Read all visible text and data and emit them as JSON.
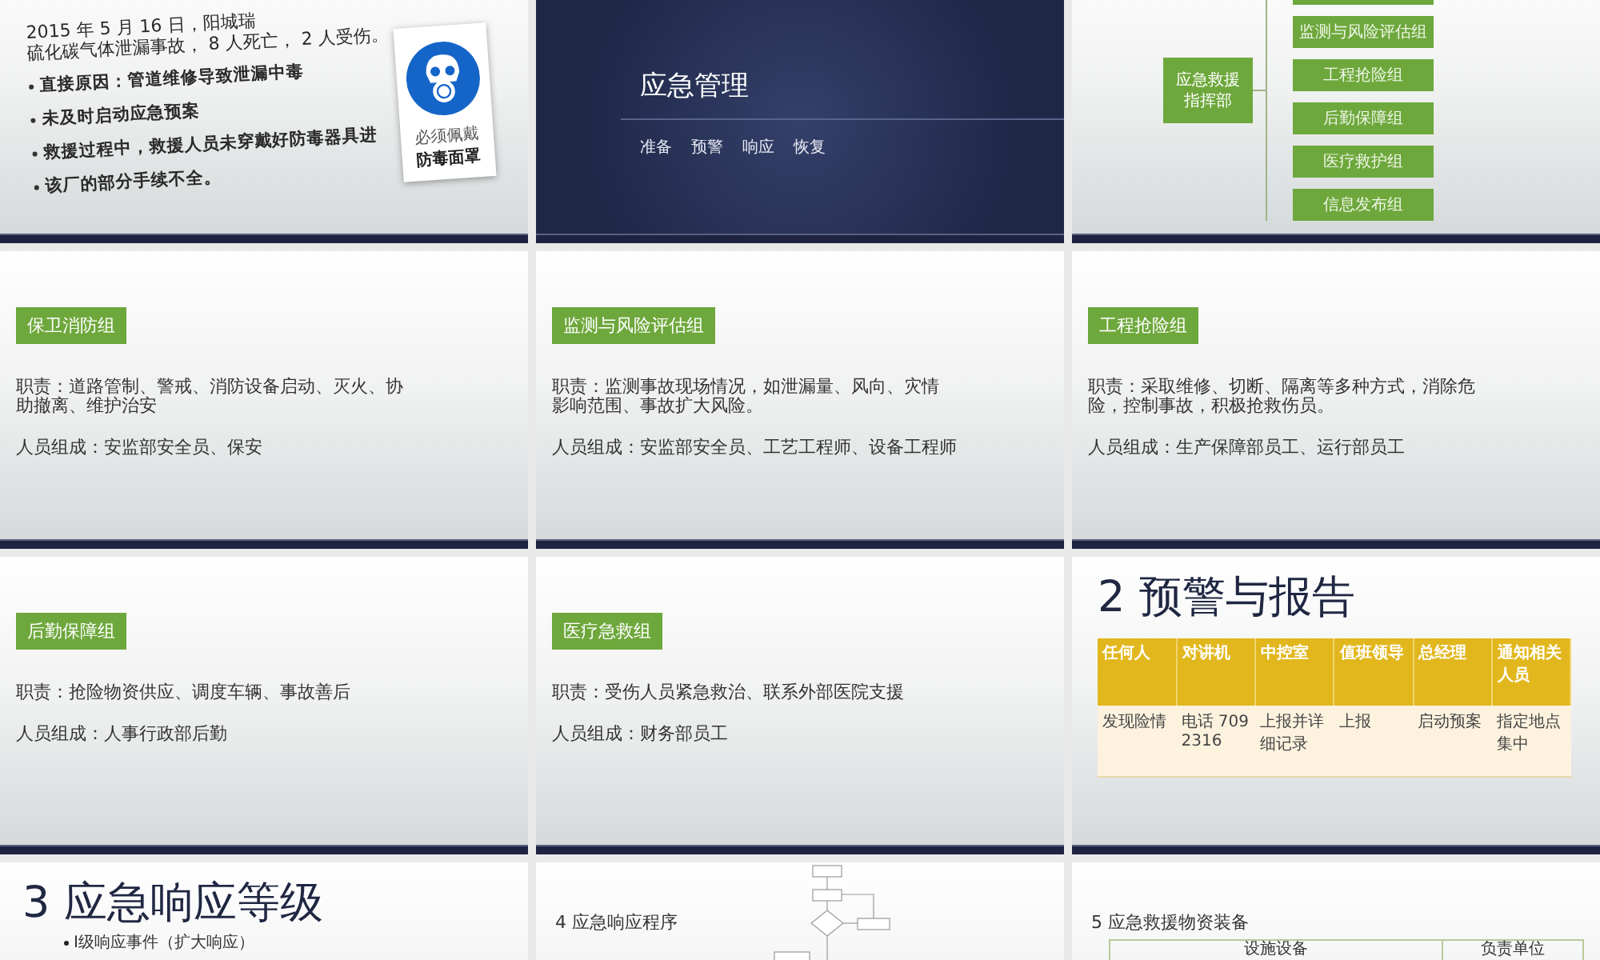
{
  "slides": [
    {
      "kind": "incident",
      "lines": [
        "2015 年 5 月 16 日，阳城瑞",
        "硫化碳气体泄漏事故， 8 人死亡， 2 人受伤。"
      ],
      "bullets": [
        "直接原因：管道维修导致泄漏中毒",
        "未及时启动应急预案",
        "救援过程中，救援人员未穿戴好防毒器具进",
        "该厂的部分手续不全。"
      ],
      "sign": [
        "必须佩戴",
        "防毒面罩"
      ]
    },
    {
      "kind": "title",
      "title": "应急管理",
      "words": [
        "准备",
        "预警",
        "响应",
        "恢复"
      ]
    },
    {
      "kind": "org",
      "head": "应急救援指挥部",
      "teams": [
        "监测与风险评估组",
        "工程抢险组",
        "后勤保障组",
        "医疗救护组",
        "信息发布组"
      ]
    },
    {
      "kind": "duty",
      "tag": "保卫消防组",
      "duty": "职责：道路管制、警戒、消防设备启动、灭火、协助撤离、维护治安",
      "staff": "人员组成：安监部安全员、保安"
    },
    {
      "kind": "duty",
      "tag": "监测与风险评估组",
      "duty": "职责：监测事故现场情况，如泄漏量、风向、灾情影响范围、事故扩大风险。",
      "staff": "人员组成：安监部安全员、工艺工程师、设备工程师"
    },
    {
      "kind": "duty",
      "tag": "工程抢险组",
      "duty": "职责：采取维修、切断、隔离等多种方式，消除危险，控制事故，积极抢救伤员。",
      "staff": "人员组成：生产保障部员工、运行部员工"
    },
    {
      "kind": "duty",
      "tag": "后勤保障组",
      "duty": "职责：抢险物资供应、调度车辆、事故善后",
      "staff": "人员组成：人事行政部后勤"
    },
    {
      "kind": "duty",
      "tag": "医疗急救组",
      "duty": "职责：受伤人员紧急救治、联系外部医院支援",
      "staff": "人员组成：财务部员工"
    },
    {
      "kind": "table",
      "title": "2 预警与报告",
      "columns": [
        "任何人",
        "对讲机",
        "中控室",
        "值班领导",
        "总经理",
        "通知相关人员"
      ],
      "rows": [
        [
          "发现险情",
          "电话 709 2316",
          "上报并详细记录",
          "上报",
          "启动预案",
          "指定地点集中"
        ]
      ]
    },
    {
      "kind": "levels",
      "title": "3 应急响应等级",
      "bullets": [
        "I级响应事件（扩大响应）"
      ]
    },
    {
      "kind": "flow",
      "title": "4 应急响应程序"
    },
    {
      "kind": "equipment",
      "title": "5 应急救援物资装备",
      "columns": [
        "设施设备",
        "负责单位"
      ]
    }
  ]
}
